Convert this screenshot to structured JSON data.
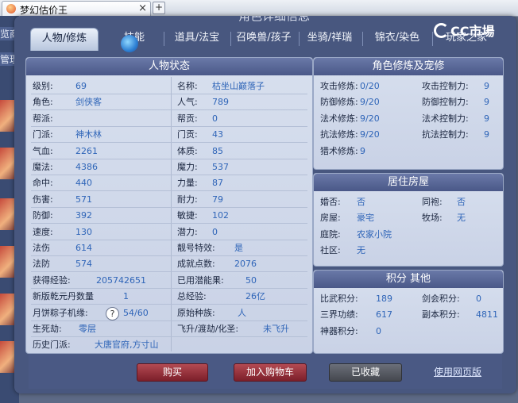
{
  "browser": {
    "tab_title": "梦幻估价王",
    "close": "×",
    "new_tab": "+"
  },
  "left_strip": {
    "text1": "览商",
    "text2": "管理"
  },
  "header_ghost": "角色详细信息",
  "logo_text": "CC市場",
  "tabs": [
    "人物/修炼",
    "技能",
    "道具/法宝",
    "召唤兽/孩子",
    "坐骑/祥瑞",
    "锦衣/染色",
    "玩家之家"
  ],
  "char_status": {
    "title": "人物状态",
    "left": [
      {
        "label": "级别:",
        "value": "69"
      },
      {
        "label": "角色:",
        "value": "剑侠客"
      },
      {
        "label": "帮派:",
        "value": ""
      },
      {
        "label": "门派:",
        "value": "神木林"
      },
      {
        "label": "气血:",
        "value": "2261"
      },
      {
        "label": "魔法:",
        "value": "4386"
      },
      {
        "label": "命中:",
        "value": "440"
      },
      {
        "label": "伤害:",
        "value": "571"
      },
      {
        "label": "防御:",
        "value": "392"
      },
      {
        "label": "速度:",
        "value": "130"
      },
      {
        "label": "法伤",
        "value": "614"
      },
      {
        "label": "法防",
        "value": "574"
      },
      {
        "label": "获得经验:",
        "value": "205742651"
      },
      {
        "label": "新版乾元丹数量",
        "value": "1"
      },
      {
        "label": "月饼粽子机缘:",
        "value": "54/60"
      },
      {
        "label": "生死劫:",
        "value": "零层"
      },
      {
        "label": "历史门派:",
        "value": "大唐官府,方寸山"
      }
    ],
    "right": [
      {
        "label": "名称:",
        "value": "枯坐山巅落子"
      },
      {
        "label": "人气:",
        "value": "789"
      },
      {
        "label": "帮贡:",
        "value": "0"
      },
      {
        "label": "门贡:",
        "value": "43"
      },
      {
        "label": "体质:",
        "value": "85"
      },
      {
        "label": "魔力:",
        "value": "537"
      },
      {
        "label": "力量:",
        "value": "87"
      },
      {
        "label": "耐力:",
        "value": "79"
      },
      {
        "label": "敏捷:",
        "value": "102"
      },
      {
        "label": "潜力:",
        "value": "0"
      },
      {
        "label": "靓号特效:",
        "value": "是"
      },
      {
        "label": "成就点数:",
        "value": "2076"
      },
      {
        "label": "已用潜能果:",
        "value": "50"
      },
      {
        "label": "总经验:",
        "value": "26亿"
      },
      {
        "label": "原始种族:",
        "value": "人"
      },
      {
        "label": "飞升/渡劫/化圣:",
        "value": "未飞升"
      }
    ],
    "help_icon": "?"
  },
  "cultivation": {
    "title": "角色修炼及宠修",
    "rows": [
      {
        "l1": "攻击修炼:",
        "v1": "0/20",
        "l2": "攻击控制力:",
        "v2": "9"
      },
      {
        "l1": "防御修炼:",
        "v1": "9/20",
        "l2": "防御控制力:",
        "v2": "9"
      },
      {
        "l1": "法术修炼:",
        "v1": "9/20",
        "l2": "法术控制力:",
        "v2": "9"
      },
      {
        "l1": "抗法修炼:",
        "v1": "9/20",
        "l2": "抗法控制力:",
        "v2": "9"
      },
      {
        "l1": "猎术修炼:",
        "v1": "9",
        "l2": "",
        "v2": ""
      }
    ]
  },
  "residence": {
    "title": "居住房屋",
    "rows": [
      {
        "l1": "婚否:",
        "v1": "否",
        "l2": "同袍:",
        "v2": "否"
      },
      {
        "l1": "房屋:",
        "v1": "豪宅",
        "l2": "牧场:",
        "v2": "无"
      },
      {
        "l1": "庭院:",
        "v1": "农家小院",
        "l2": "",
        "v2": ""
      },
      {
        "l1": "社区:",
        "v1": "无",
        "l2": "",
        "v2": ""
      }
    ]
  },
  "points": {
    "title": "积分 其他",
    "rows": [
      {
        "l1": "比武积分:",
        "v1": "189",
        "l2": "剑会积分:",
        "v2": "0"
      },
      {
        "l1": "三界功绩:",
        "v1": "617",
        "l2": "副本积分:",
        "v2": "4811"
      },
      {
        "l1": "神器积分:",
        "v1": "0",
        "l2": "",
        "v2": ""
      }
    ]
  },
  "footer": {
    "buy": "购买",
    "add_cart": "加入购物车",
    "collected": "已收藏",
    "web_link": "使用网页版"
  }
}
